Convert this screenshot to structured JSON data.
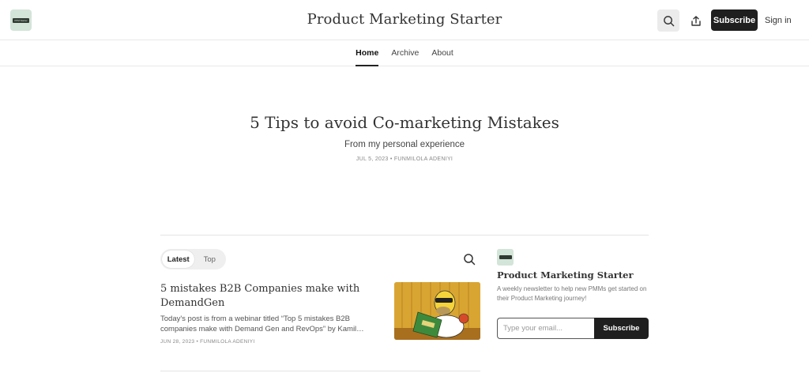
{
  "header": {
    "logo_text": "PPM Starter",
    "site_title": "Product Marketing Starter",
    "subscribe_label": "Subscribe",
    "signin_label": "Sign in"
  },
  "nav": {
    "items": [
      {
        "label": "Home",
        "active": true
      },
      {
        "label": "Archive",
        "active": false
      },
      {
        "label": "About",
        "active": false
      }
    ]
  },
  "hero": {
    "title": "5 Tips to avoid Co-marketing Mistakes",
    "subtitle": "From my personal experience",
    "meta": "JUL 5, 2023 • FUNMILOLA ADENIYI"
  },
  "feed": {
    "tabs": [
      {
        "label": "Latest",
        "active": true
      },
      {
        "label": "Top",
        "active": false
      }
    ],
    "posts": [
      {
        "title": "5 mistakes B2B Companies make with DemandGen",
        "excerpt": "Today's post is from a webinar titled “Top 5 mistakes B2B companies make with Demand Gen and RevOps” by Kamil…",
        "meta": "JUN 28, 2023 • FUNMILOLA ADENIYI"
      }
    ]
  },
  "sidebar": {
    "title": "Product Marketing Starter",
    "description": "A weekly newsletter to help new PMMs get started on their Product Marketing journey!",
    "email_placeholder": "Type your email...",
    "subscribe_label": "Subscribe"
  },
  "colors": {
    "accent": "#1f1f1f",
    "logo_bg": "#d3e4d8"
  }
}
